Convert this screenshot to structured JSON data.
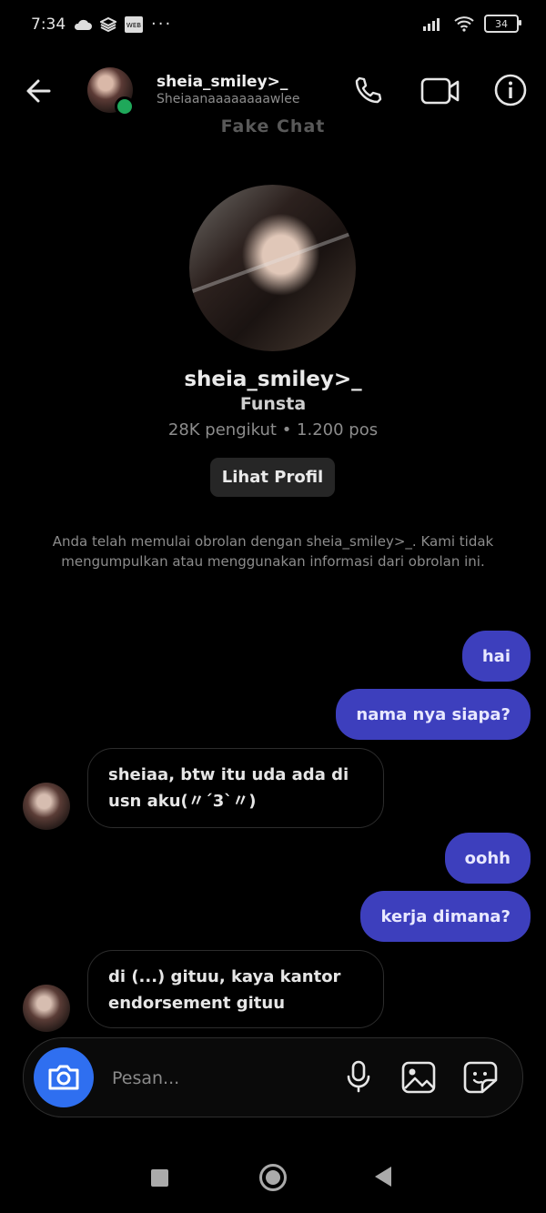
{
  "status_bar": {
    "time": "7:34",
    "battery": "34"
  },
  "header": {
    "display_name": "sheia_smiley>_",
    "username": "Sheiaanaaaaaaaawlee",
    "watermark": "Fake Chat"
  },
  "profile": {
    "name": "sheia_smiley>_",
    "subtitle": "Funsta",
    "stats": "28K pengikut • 1.200 pos",
    "view_button": "Lihat Profil",
    "notice": "Anda telah memulai obrolan dengan sheia_smiley>_. Kami tidak mengumpulkan atau menggunakan informasi dari obrolan ini."
  },
  "messages": [
    {
      "from": "me",
      "text": "hai"
    },
    {
      "from": "me",
      "text": "nama nya siapa?"
    },
    {
      "from": "them",
      "text": "sheiaa, btw itu uda ada di usn aku(〃ˊ3ˋ〃)"
    },
    {
      "from": "me",
      "text": "oohh"
    },
    {
      "from": "me",
      "text": "kerja dimana?"
    },
    {
      "from": "them",
      "text": "di (...) gituu, kaya kantor endorsement gituu"
    }
  ],
  "composer": {
    "placeholder": "Pesan..."
  },
  "colors": {
    "outgoing_bubble": "#3d3fbd",
    "camera_button": "#2f6ff0",
    "online_dot": "#1fa85a"
  }
}
